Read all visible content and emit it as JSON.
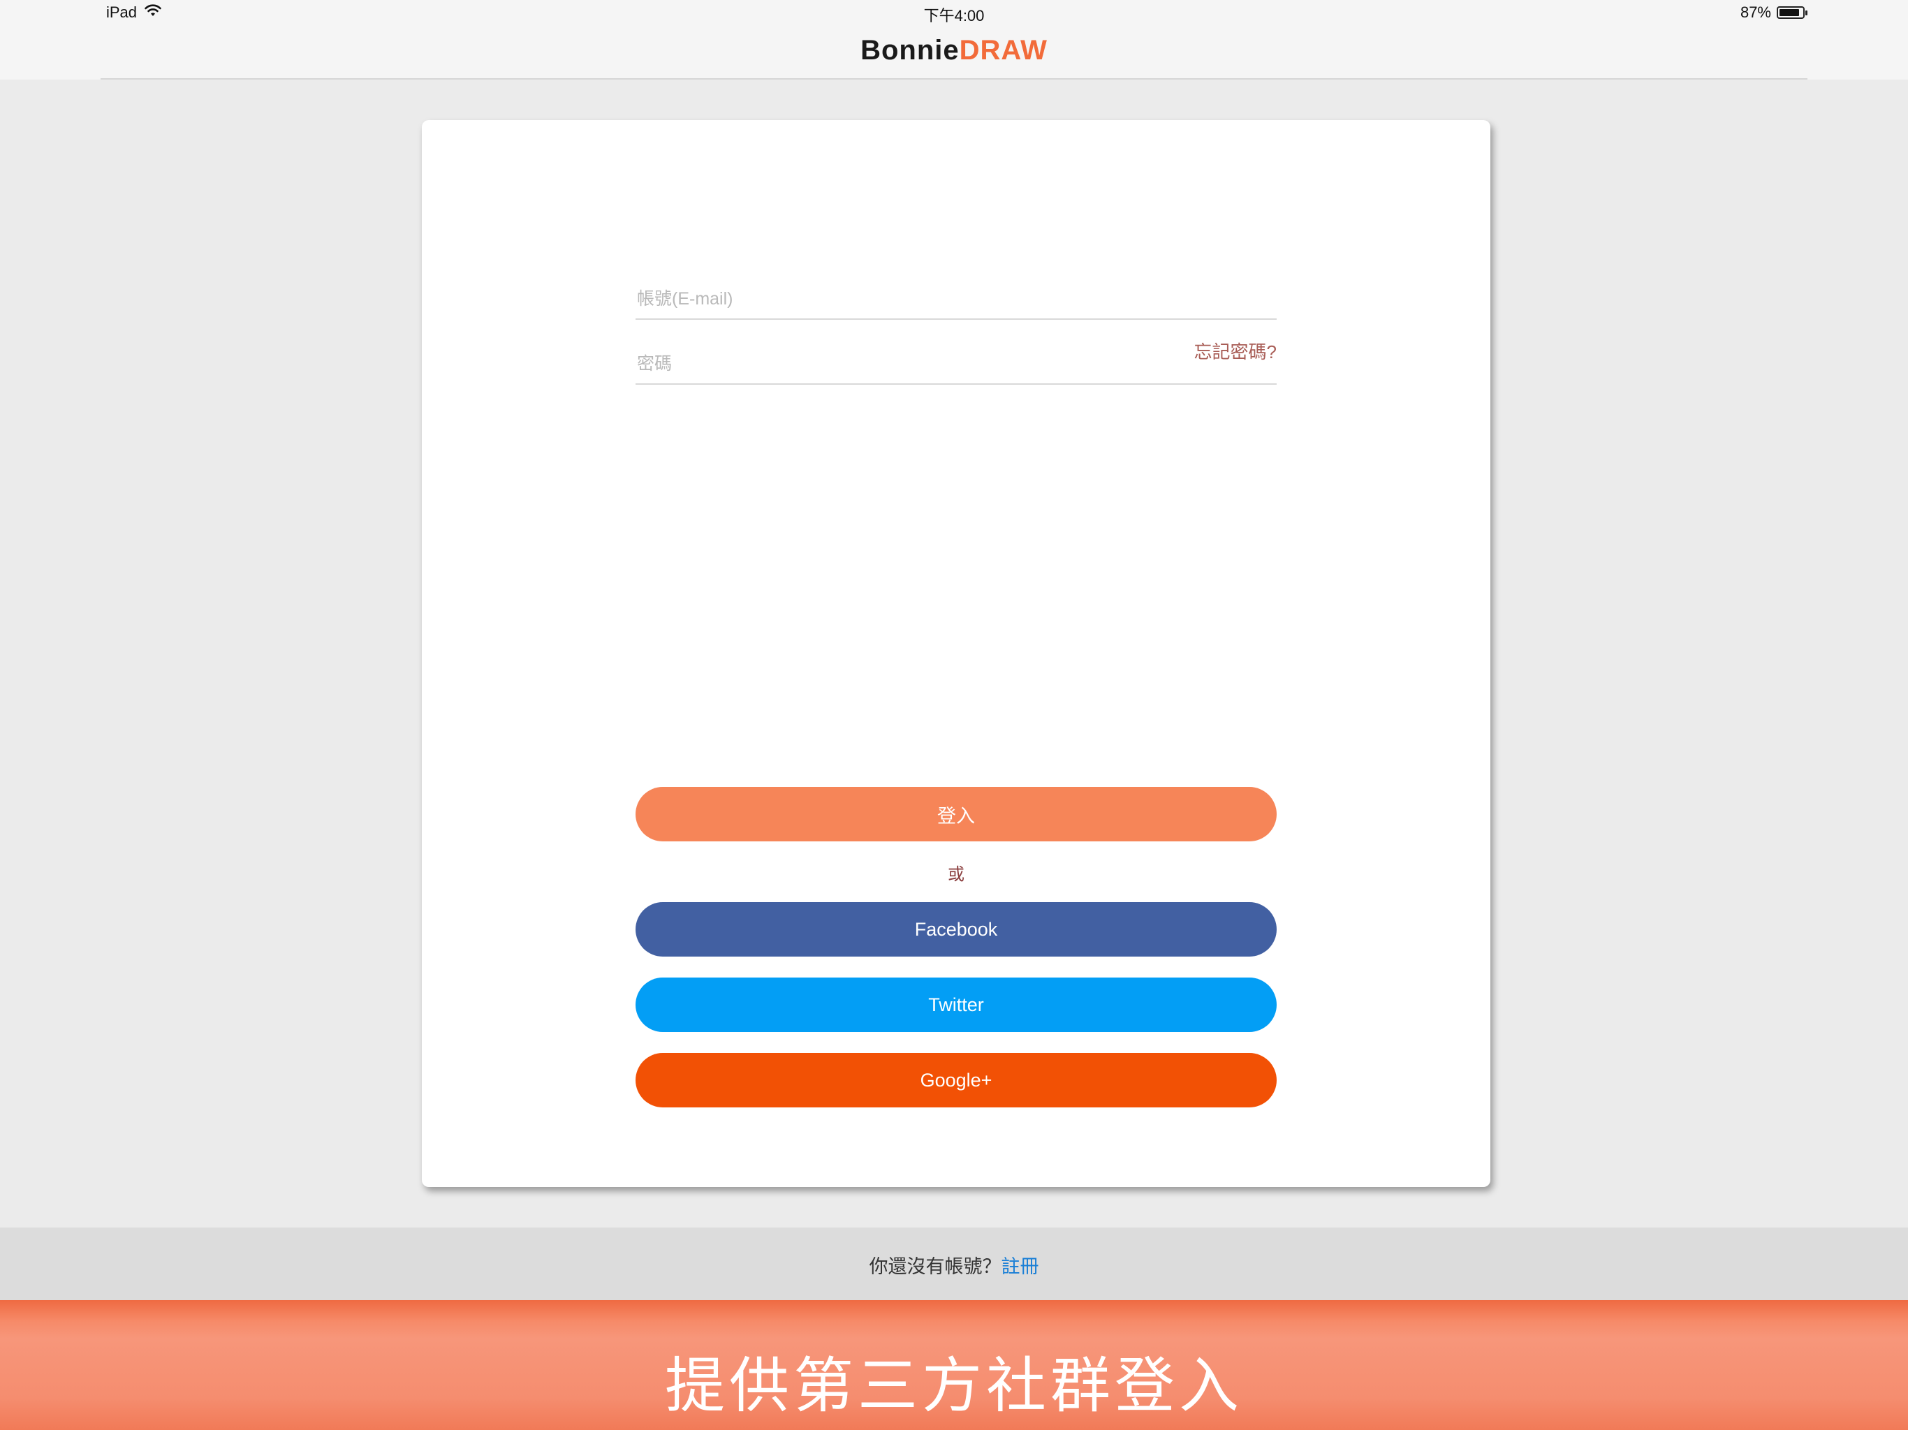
{
  "status_bar": {
    "device": "iPad",
    "time": "下午4:00",
    "battery_text": "87%",
    "battery_level": 0.87
  },
  "nav": {
    "logo_part1": "Bonnie",
    "logo_part2": "DRAW"
  },
  "login_form": {
    "email_placeholder": "帳號(E-mail)",
    "email_value": "",
    "password_placeholder": "密碼",
    "password_value": "",
    "forgot_password": "忘記密碼?",
    "login_button": "登入",
    "or_text": "或",
    "facebook_button": "Facebook",
    "twitter_button": "Twitter",
    "google_button": "Google+"
  },
  "footer": {
    "prompt": "你還沒有帳號？",
    "register_link": "註冊"
  },
  "banner": {
    "caption": "提供第三方社群登入"
  },
  "colors": {
    "brand_orange": "#f26b3a",
    "login_button": "#f68558",
    "facebook": "#4260a2",
    "twitter": "#039ef5",
    "google": "#f25105",
    "link_blue": "#1a7fd6"
  },
  "icons": {
    "wifi": "wifi-icon",
    "battery": "battery-icon"
  }
}
